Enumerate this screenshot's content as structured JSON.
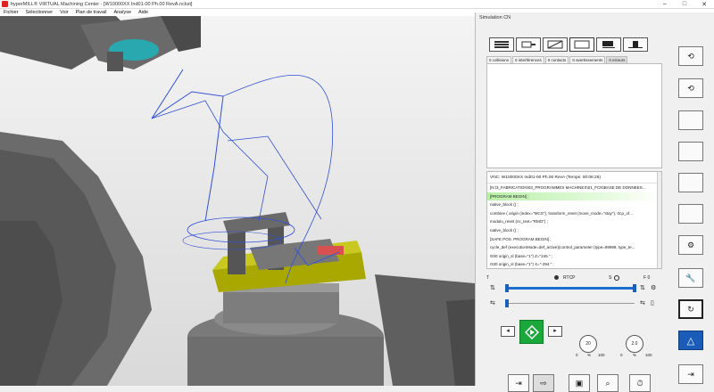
{
  "window": {
    "title": "hyperMILL® VIRTUAL Machining Center - [W10000XX Ind01-00 Ph.00 RevA.nckst]",
    "controls": [
      "–",
      "□",
      "✕"
    ]
  },
  "menu": [
    "Fichier",
    "Sélectionner",
    "Voir",
    "Plan de travail",
    "Analyse",
    "Aide"
  ],
  "panel": {
    "title": "Simulation CN",
    "close": "✕",
    "tabs": [
      "0 collisions",
      "0 interférences",
      "0 contacts",
      "0 avertissements",
      "0 erreurs"
    ],
    "nc_header": "VNC: W10000XX Ind01-00 Ph.00 RevA (Temps: 00:06:26)",
    "nc_lines": [
      "[N:\\3_FABRICATION\\03_PROGRAMMES MACHINES\\01_FCN\\BASE DE DONNEES...",
      "[PROGRAM BEGIN] ;",
      "native_block () ;",
      "combine ( origin (index=\"MCS\"), transform_reset (move_mode=\"stay\"), rtcp_of...",
      "modulo_reset (nc_text=\"RMO\") ;",
      "native_block () ;",
      "[SAFE POS. PROGRAM BEGIN] ;",
      "cycle_def (executionMode=def_active)(control_parameter (type=99999, type_te...",
      "G00   origin_sl (base=\"1\") Z=\"245.\" ;",
      "G00   origin_sl (base=\"1\") X=\"-294.\" ;"
    ],
    "status": {
      "t": "T",
      "rtcp": "RTCP",
      "s": "S",
      "f": "F 0"
    },
    "dials": {
      "speed_value": "20",
      "speed_max": "100",
      "speed_unit": "%",
      "rate_value": "2.0",
      "rate_max": "100",
      "rate_unit": "%"
    },
    "slider_min": "0"
  },
  "colors": {
    "accent": "#1e6fd0",
    "play": "#1aa83a",
    "highlight": "#b8f0a8",
    "warning": "#1a5cb8"
  }
}
